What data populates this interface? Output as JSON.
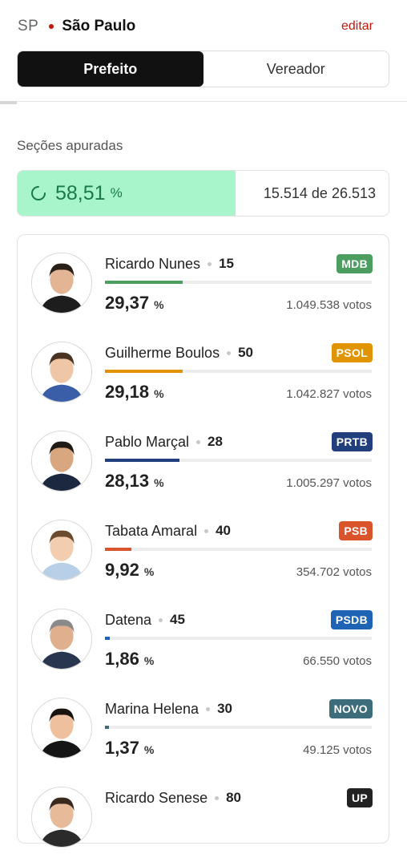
{
  "header": {
    "state": "SP",
    "city": "São Paulo",
    "edit_label": "editar"
  },
  "tabs": [
    {
      "label": "Prefeito",
      "active": true
    },
    {
      "label": "Vereador",
      "active": false
    }
  ],
  "sections": {
    "label": "Seções apuradas",
    "percent": "58,51",
    "percent_symbol": "%",
    "progress_fraction": 0.5851,
    "count_text": "15.514 de 26.513"
  },
  "candidates": [
    {
      "name": "Ricardo Nunes",
      "number": "15",
      "party": "MDB",
      "party_color": "#4b9e5f",
      "percent": "29,37",
      "percent_symbol": "%",
      "votes": "1.049.538 votos",
      "share": 0.2937
    },
    {
      "name": "Guilherme Boulos",
      "number": "50",
      "party": "PSOL",
      "party_color": "#e09500",
      "percent": "29,18",
      "percent_symbol": "%",
      "votes": "1.042.827 votos",
      "share": 0.2918
    },
    {
      "name": "Pablo Marçal",
      "number": "28",
      "party": "PRTB",
      "party_color": "#213e7d",
      "percent": "28,13",
      "percent_symbol": "%",
      "votes": "1.005.297 votos",
      "share": 0.2813
    },
    {
      "name": "Tabata Amaral",
      "number": "40",
      "party": "PSB",
      "party_color": "#d9532b",
      "percent": "9,92",
      "percent_symbol": "%",
      "votes": "354.702 votos",
      "share": 0.0992
    },
    {
      "name": "Datena",
      "number": "45",
      "party": "PSDB",
      "party_color": "#1f63b5",
      "percent": "1,86",
      "percent_symbol": "%",
      "votes": "66.550 votos",
      "share": 0.0186
    },
    {
      "name": "Marina Helena",
      "number": "30",
      "party": "NOVO",
      "party_color": "#3d6c7a",
      "percent": "1,37",
      "percent_symbol": "%",
      "votes": "49.125 votos",
      "share": 0.0137
    },
    {
      "name": "Ricardo Senese",
      "number": "80",
      "party": "UP",
      "party_color": "#222222",
      "percent": "",
      "percent_symbol": "",
      "votes": "",
      "share": 0
    }
  ],
  "icons": {
    "spinner": "loading-spinner-icon",
    "avatar": "candidate-photo"
  }
}
